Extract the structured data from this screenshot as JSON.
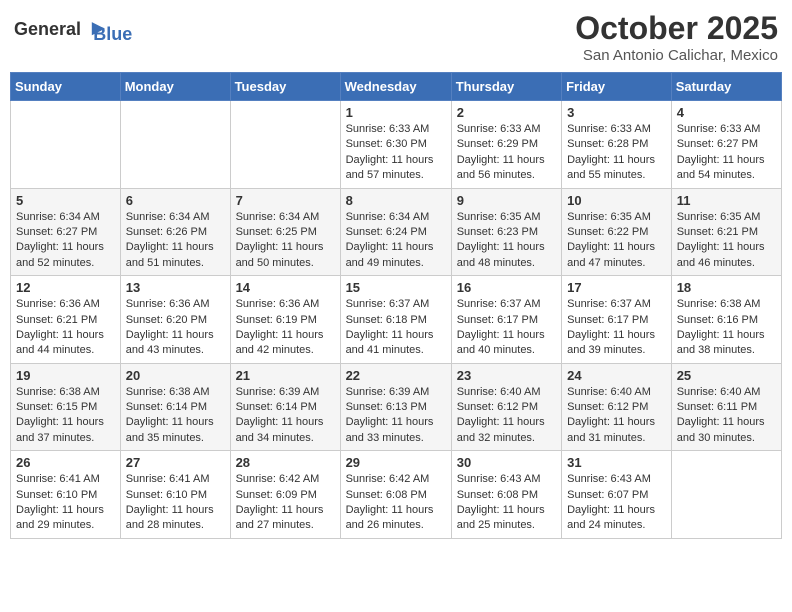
{
  "logo": {
    "general": "General",
    "blue": "Blue"
  },
  "title": "October 2025",
  "location": "San Antonio Calichar, Mexico",
  "days_of_week": [
    "Sunday",
    "Monday",
    "Tuesday",
    "Wednesday",
    "Thursday",
    "Friday",
    "Saturday"
  ],
  "weeks": [
    [
      {
        "day": "",
        "sunrise": "",
        "sunset": "",
        "daylight": ""
      },
      {
        "day": "",
        "sunrise": "",
        "sunset": "",
        "daylight": ""
      },
      {
        "day": "",
        "sunrise": "",
        "sunset": "",
        "daylight": ""
      },
      {
        "day": "1",
        "sunrise": "Sunrise: 6:33 AM",
        "sunset": "Sunset: 6:30 PM",
        "daylight": "Daylight: 11 hours and 57 minutes."
      },
      {
        "day": "2",
        "sunrise": "Sunrise: 6:33 AM",
        "sunset": "Sunset: 6:29 PM",
        "daylight": "Daylight: 11 hours and 56 minutes."
      },
      {
        "day": "3",
        "sunrise": "Sunrise: 6:33 AM",
        "sunset": "Sunset: 6:28 PM",
        "daylight": "Daylight: 11 hours and 55 minutes."
      },
      {
        "day": "4",
        "sunrise": "Sunrise: 6:33 AM",
        "sunset": "Sunset: 6:27 PM",
        "daylight": "Daylight: 11 hours and 54 minutes."
      }
    ],
    [
      {
        "day": "5",
        "sunrise": "Sunrise: 6:34 AM",
        "sunset": "Sunset: 6:27 PM",
        "daylight": "Daylight: 11 hours and 52 minutes."
      },
      {
        "day": "6",
        "sunrise": "Sunrise: 6:34 AM",
        "sunset": "Sunset: 6:26 PM",
        "daylight": "Daylight: 11 hours and 51 minutes."
      },
      {
        "day": "7",
        "sunrise": "Sunrise: 6:34 AM",
        "sunset": "Sunset: 6:25 PM",
        "daylight": "Daylight: 11 hours and 50 minutes."
      },
      {
        "day": "8",
        "sunrise": "Sunrise: 6:34 AM",
        "sunset": "Sunset: 6:24 PM",
        "daylight": "Daylight: 11 hours and 49 minutes."
      },
      {
        "day": "9",
        "sunrise": "Sunrise: 6:35 AM",
        "sunset": "Sunset: 6:23 PM",
        "daylight": "Daylight: 11 hours and 48 minutes."
      },
      {
        "day": "10",
        "sunrise": "Sunrise: 6:35 AM",
        "sunset": "Sunset: 6:22 PM",
        "daylight": "Daylight: 11 hours and 47 minutes."
      },
      {
        "day": "11",
        "sunrise": "Sunrise: 6:35 AM",
        "sunset": "Sunset: 6:21 PM",
        "daylight": "Daylight: 11 hours and 46 minutes."
      }
    ],
    [
      {
        "day": "12",
        "sunrise": "Sunrise: 6:36 AM",
        "sunset": "Sunset: 6:21 PM",
        "daylight": "Daylight: 11 hours and 44 minutes."
      },
      {
        "day": "13",
        "sunrise": "Sunrise: 6:36 AM",
        "sunset": "Sunset: 6:20 PM",
        "daylight": "Daylight: 11 hours and 43 minutes."
      },
      {
        "day": "14",
        "sunrise": "Sunrise: 6:36 AM",
        "sunset": "Sunset: 6:19 PM",
        "daylight": "Daylight: 11 hours and 42 minutes."
      },
      {
        "day": "15",
        "sunrise": "Sunrise: 6:37 AM",
        "sunset": "Sunset: 6:18 PM",
        "daylight": "Daylight: 11 hours and 41 minutes."
      },
      {
        "day": "16",
        "sunrise": "Sunrise: 6:37 AM",
        "sunset": "Sunset: 6:17 PM",
        "daylight": "Daylight: 11 hours and 40 minutes."
      },
      {
        "day": "17",
        "sunrise": "Sunrise: 6:37 AM",
        "sunset": "Sunset: 6:17 PM",
        "daylight": "Daylight: 11 hours and 39 minutes."
      },
      {
        "day": "18",
        "sunrise": "Sunrise: 6:38 AM",
        "sunset": "Sunset: 6:16 PM",
        "daylight": "Daylight: 11 hours and 38 minutes."
      }
    ],
    [
      {
        "day": "19",
        "sunrise": "Sunrise: 6:38 AM",
        "sunset": "Sunset: 6:15 PM",
        "daylight": "Daylight: 11 hours and 37 minutes."
      },
      {
        "day": "20",
        "sunrise": "Sunrise: 6:38 AM",
        "sunset": "Sunset: 6:14 PM",
        "daylight": "Daylight: 11 hours and 35 minutes."
      },
      {
        "day": "21",
        "sunrise": "Sunrise: 6:39 AM",
        "sunset": "Sunset: 6:14 PM",
        "daylight": "Daylight: 11 hours and 34 minutes."
      },
      {
        "day": "22",
        "sunrise": "Sunrise: 6:39 AM",
        "sunset": "Sunset: 6:13 PM",
        "daylight": "Daylight: 11 hours and 33 minutes."
      },
      {
        "day": "23",
        "sunrise": "Sunrise: 6:40 AM",
        "sunset": "Sunset: 6:12 PM",
        "daylight": "Daylight: 11 hours and 32 minutes."
      },
      {
        "day": "24",
        "sunrise": "Sunrise: 6:40 AM",
        "sunset": "Sunset: 6:12 PM",
        "daylight": "Daylight: 11 hours and 31 minutes."
      },
      {
        "day": "25",
        "sunrise": "Sunrise: 6:40 AM",
        "sunset": "Sunset: 6:11 PM",
        "daylight": "Daylight: 11 hours and 30 minutes."
      }
    ],
    [
      {
        "day": "26",
        "sunrise": "Sunrise: 6:41 AM",
        "sunset": "Sunset: 6:10 PM",
        "daylight": "Daylight: 11 hours and 29 minutes."
      },
      {
        "day": "27",
        "sunrise": "Sunrise: 6:41 AM",
        "sunset": "Sunset: 6:10 PM",
        "daylight": "Daylight: 11 hours and 28 minutes."
      },
      {
        "day": "28",
        "sunrise": "Sunrise: 6:42 AM",
        "sunset": "Sunset: 6:09 PM",
        "daylight": "Daylight: 11 hours and 27 minutes."
      },
      {
        "day": "29",
        "sunrise": "Sunrise: 6:42 AM",
        "sunset": "Sunset: 6:08 PM",
        "daylight": "Daylight: 11 hours and 26 minutes."
      },
      {
        "day": "30",
        "sunrise": "Sunrise: 6:43 AM",
        "sunset": "Sunset: 6:08 PM",
        "daylight": "Daylight: 11 hours and 25 minutes."
      },
      {
        "day": "31",
        "sunrise": "Sunrise: 6:43 AM",
        "sunset": "Sunset: 6:07 PM",
        "daylight": "Daylight: 11 hours and 24 minutes."
      },
      {
        "day": "",
        "sunrise": "",
        "sunset": "",
        "daylight": ""
      }
    ]
  ]
}
